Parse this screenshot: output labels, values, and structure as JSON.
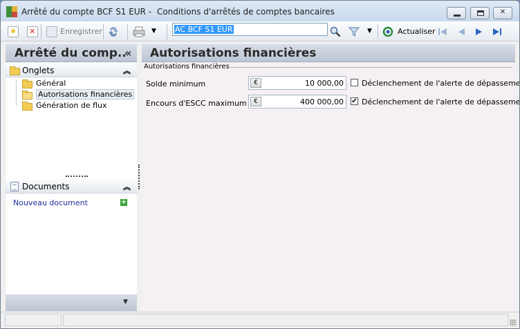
{
  "window": {
    "title_part1": "Arrêté du compte BCF S1 EUR -",
    "title_part2": "Conditions d'arrêtés de comptes bancaires",
    "buttons": {
      "minimize": "minimize",
      "maximize": "maximize",
      "close": "close"
    }
  },
  "toolbar": {
    "save_label": "Enregistrer",
    "search_value": "AC BCF S1 EUR",
    "refresh_label": "Actualiser",
    "icons": [
      "new-icon",
      "delete-icon",
      "save-icon",
      "sync-icon",
      "print-icon",
      "search-icon",
      "filter-icon",
      "refresh-icon",
      "first-icon",
      "previous-icon",
      "next-icon",
      "last-icon"
    ]
  },
  "left_panel": {
    "title": "Arrêté du comp..",
    "collapse_glyph": "«",
    "onglets_label": "Onglets",
    "tree": [
      {
        "label": "Général"
      },
      {
        "label": "Autorisations financières"
      },
      {
        "label": "Génération de flux"
      }
    ],
    "documents_label": "Documents",
    "new_document_label": "Nouveau document"
  },
  "content": {
    "title": "Autorisations financières",
    "fieldset": "Autorisations financières",
    "fields": [
      {
        "label": "Solde minimum",
        "currency": "€",
        "value": "10 000,00",
        "checked": false,
        "check_label": "Déclenchement de l'alerte de dépassement"
      },
      {
        "label": "Encours d'ESCC maximum",
        "currency": "€",
        "value": "400 000,00",
        "checked": true,
        "check_label": "Déclenchement de l'alerte de dépassement"
      }
    ]
  },
  "colors": {
    "header_bg": "#c9d3de",
    "content_bg": "#f4f0f3",
    "link": "#1f2f9a",
    "selection": "#3399ff"
  }
}
